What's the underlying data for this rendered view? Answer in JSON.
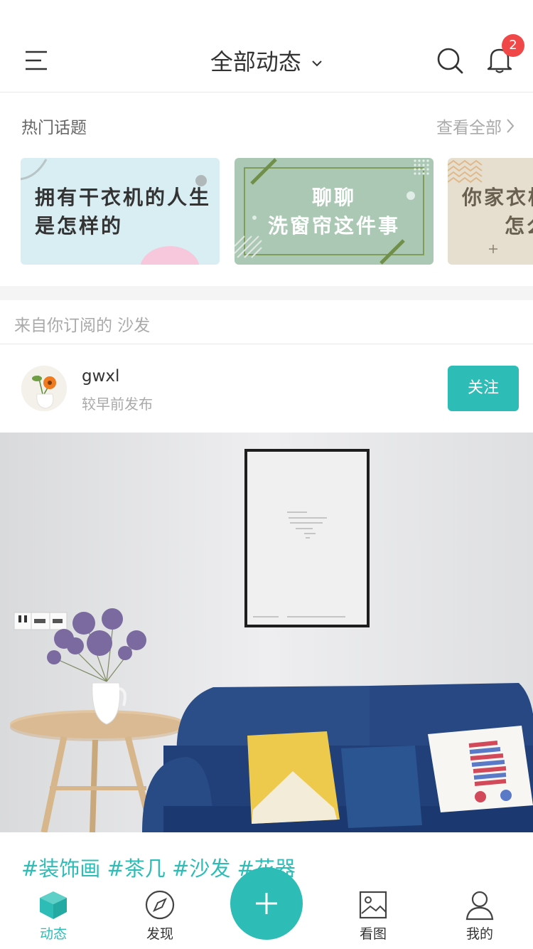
{
  "header": {
    "title": "全部动态",
    "menu_icon": "menu-icon",
    "search_icon": "search-icon",
    "bell_icon": "bell-icon",
    "notification_count": "2"
  },
  "hot_topics": {
    "title": "热门话题",
    "see_all": "查看全部",
    "cards": [
      {
        "line1": "拥有干衣机的人生",
        "line2": "是怎样的",
        "color": "#d9eef2"
      },
      {
        "line1": "聊聊",
        "line2": "洗窗帘这件事",
        "color": "#abc8b4"
      },
      {
        "line1": "你家衣柜",
        "line2": "怎么",
        "color": "#e6dfd0"
      }
    ]
  },
  "feed": {
    "subscription_label": "来自你订阅的 沙发",
    "post": {
      "username": "gwxl",
      "time": "较早前发布",
      "follow_label": "关注",
      "tags": "#装饰画 #茶几 #沙发 #花器"
    }
  },
  "tabbar": {
    "items": [
      {
        "label": "动态",
        "icon": "cube-icon",
        "active": true
      },
      {
        "label": "发现",
        "icon": "compass-icon",
        "active": false
      },
      {
        "label": "看图",
        "icon": "image-icon",
        "active": false
      },
      {
        "label": "我的",
        "icon": "person-icon",
        "active": false
      }
    ],
    "fab_icon": "plus-icon"
  },
  "colors": {
    "accent": "#2ebcb6",
    "badge": "#f04848"
  }
}
